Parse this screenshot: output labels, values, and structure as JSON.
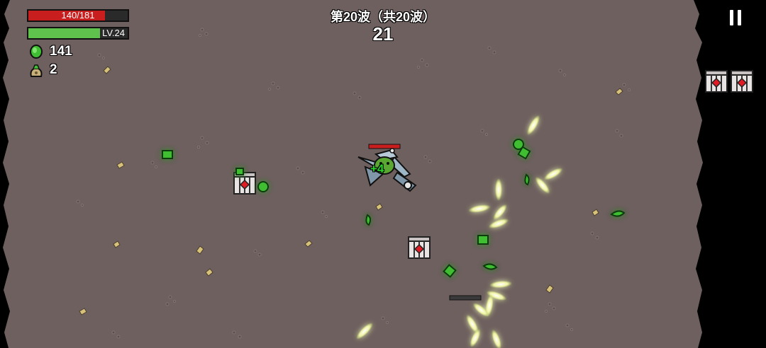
{
  "hud": {
    "hp_text": "140/181",
    "hp_current": 140,
    "hp_max": 181,
    "level_text": "LV.24",
    "xp_fraction": 0.72,
    "materials_count": "141",
    "bag_count": "2"
  },
  "wave": {
    "label": "第20波（共20波）",
    "timer": "21"
  },
  "pending_crates": 2,
  "floating_text": "+4",
  "colors": {
    "ground": "#6e605f",
    "hp": "#c81e1e",
    "xp": "#5fc24c",
    "material": "#37b42d",
    "projectile": "#f1f3a6"
  }
}
